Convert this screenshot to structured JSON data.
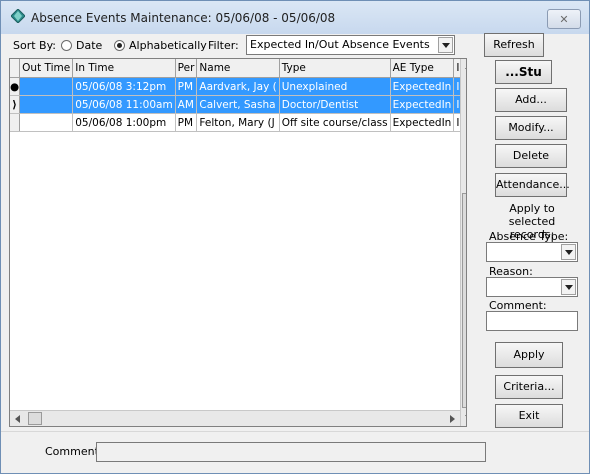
{
  "window": {
    "title": "Absence Events Maintenance: 05/06/08 - 05/06/08",
    "close_glyph": "✕"
  },
  "toolbar": {
    "sort_by_label": "Sort By:",
    "sort_date_label": "Date",
    "sort_alpha_label": "Alphabetically",
    "sort_selected": "Alphabetically",
    "filter_label": "Filter:",
    "filter_value": "Expected In/Out Absence Events",
    "refresh_label": "Refresh"
  },
  "grid": {
    "columns": [
      "",
      "Out Time",
      "In Time",
      "Per",
      "Name",
      "Type",
      "AE Type",
      "In/Out"
    ],
    "rows": [
      {
        "ind": "●",
        "selected": true,
        "cells": [
          "",
          "05/06/08 3:12pm",
          "PM",
          "Aardvark, Jay (",
          "Unexplained",
          "ExpectedIn",
          "In"
        ]
      },
      {
        "ind": "⟩",
        "selected": true,
        "cells": [
          "",
          "05/06/08 11:00am",
          "AM",
          "Calvert, Sasha",
          "Doctor/Dentist",
          "ExpectedIn",
          "In"
        ]
      },
      {
        "ind": "",
        "selected": false,
        "cells": [
          "",
          "05/06/08 1:00pm",
          "PM",
          "Felton, Mary (J",
          "Off site course/class",
          "ExpectedIn",
          "In"
        ]
      }
    ]
  },
  "side": {
    "stu_label": "...Stu",
    "add_label": "Add...",
    "modify_label": "Modify...",
    "delete_label": "Delete",
    "attendance_label": "Attendance...",
    "apply_heading": "Apply to selected records:",
    "absence_type_label": "Absence Type:",
    "absence_type_value": "",
    "reason_label": "Reason:",
    "reason_value": "",
    "comment_label": "Comment:",
    "comment_value": "",
    "apply_label": "Apply",
    "criteria_label": "Criteria...",
    "exit_label": "Exit"
  },
  "footer": {
    "comment_label": "Comment:",
    "comment_value": ""
  }
}
